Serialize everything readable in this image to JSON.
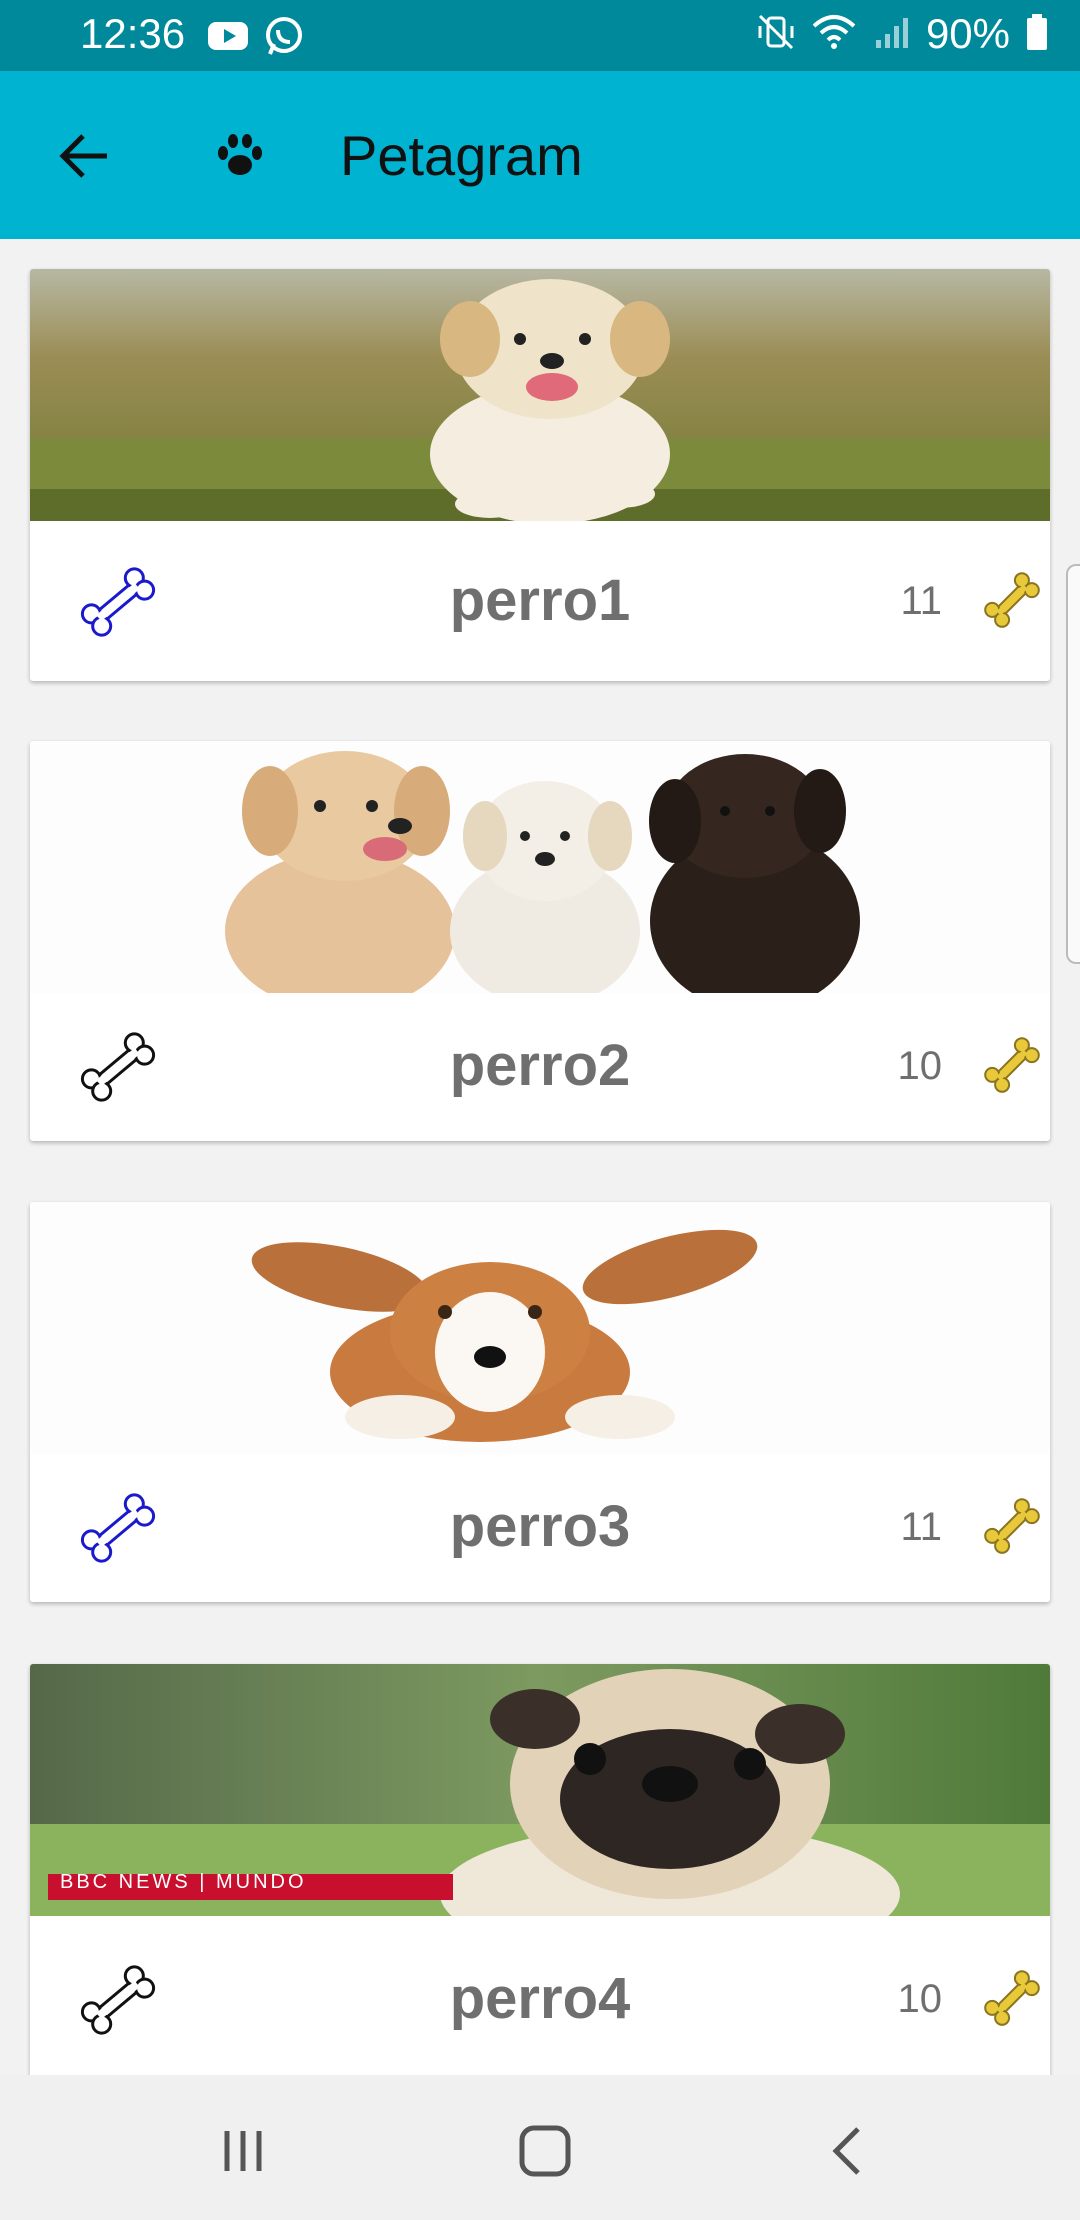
{
  "status_bar": {
    "time": "12:36",
    "battery": "90%",
    "left_icons": [
      "youtube-icon",
      "whatsapp-icon"
    ],
    "right_icons": [
      "mute-vibrate-icon",
      "wifi-icon",
      "signal-icon",
      "battery-icon"
    ]
  },
  "app_bar": {
    "title": "Petagram",
    "back_icon": "arrow-left-icon",
    "logo_icon": "paw-icon"
  },
  "pets": [
    {
      "name": "perro1",
      "likes": "11",
      "left_bone_color": "#1a1acc",
      "photo": "golden-puppy-running-photo"
    },
    {
      "name": "perro2",
      "likes": "10",
      "left_bone_color": "#111111",
      "photo": "three-puppies-photo"
    },
    {
      "name": "perro3",
      "likes": "11",
      "left_bone_color": "#1a1acc",
      "photo": "corgi-puppy-photo"
    },
    {
      "name": "perro4",
      "likes": "10",
      "left_bone_color": "#111111",
      "photo": "pug-photo",
      "photo_caption": "BBC NEWS | MUNDO"
    }
  ],
  "colors": {
    "status_bar": "#00899b",
    "app_bar": "#00b3d0",
    "bone_gold": "#e8c93a",
    "name_gray": "#6f6f6f"
  },
  "nav": [
    "recents-icon",
    "home-icon",
    "back-icon"
  ]
}
